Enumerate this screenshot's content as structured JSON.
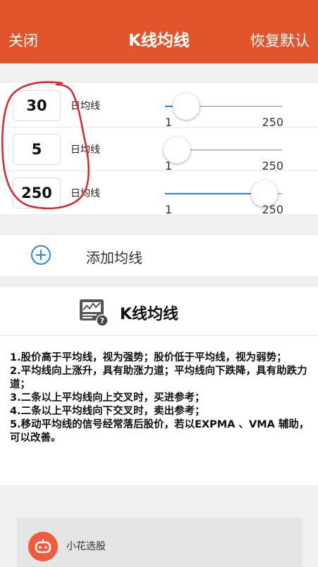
{
  "header": {
    "close_label": "关闭",
    "title": "K线均线",
    "reset_label": "恢复默认",
    "bg_color": "#e2542b"
  },
  "moving_averages": [
    {
      "days": "30",
      "label": "日均线",
      "slider_min": "1",
      "slider_max": "250",
      "slider_fraction": 0.18
    },
    {
      "days": "5",
      "label": "日均线",
      "slider_min": "1",
      "slider_max": "250",
      "slider_fraction": 0.1
    },
    {
      "days": "250",
      "label": "日均线",
      "slider_min": "1",
      "slider_max": "250",
      "slider_fraction": 0.85
    }
  ],
  "add_ma": {
    "label": "添加均线",
    "icon": "plus-circle-icon",
    "accent_color": "#2b83e6"
  },
  "info": {
    "title": "K线均线",
    "icon": "chart-help-icon",
    "lines": [
      "1.股价高于平均线，视为强势；股价低于平均线，视为弱势；",
      "2.平均线向上涨升，具有助涨力道；平均线向下跌降，具有助跌力道；",
      "3.二条以上平均线向上交叉时，买进参考；",
      "4.二条以上平均线向下交叉时，卖出参考；",
      "5.移动平均线的信号经常落后股价，若以EXPMA 、VMA 辅助，可以改善。"
    ]
  },
  "promo": {
    "text": "小花选股",
    "icon": "flower-robot-logo"
  }
}
